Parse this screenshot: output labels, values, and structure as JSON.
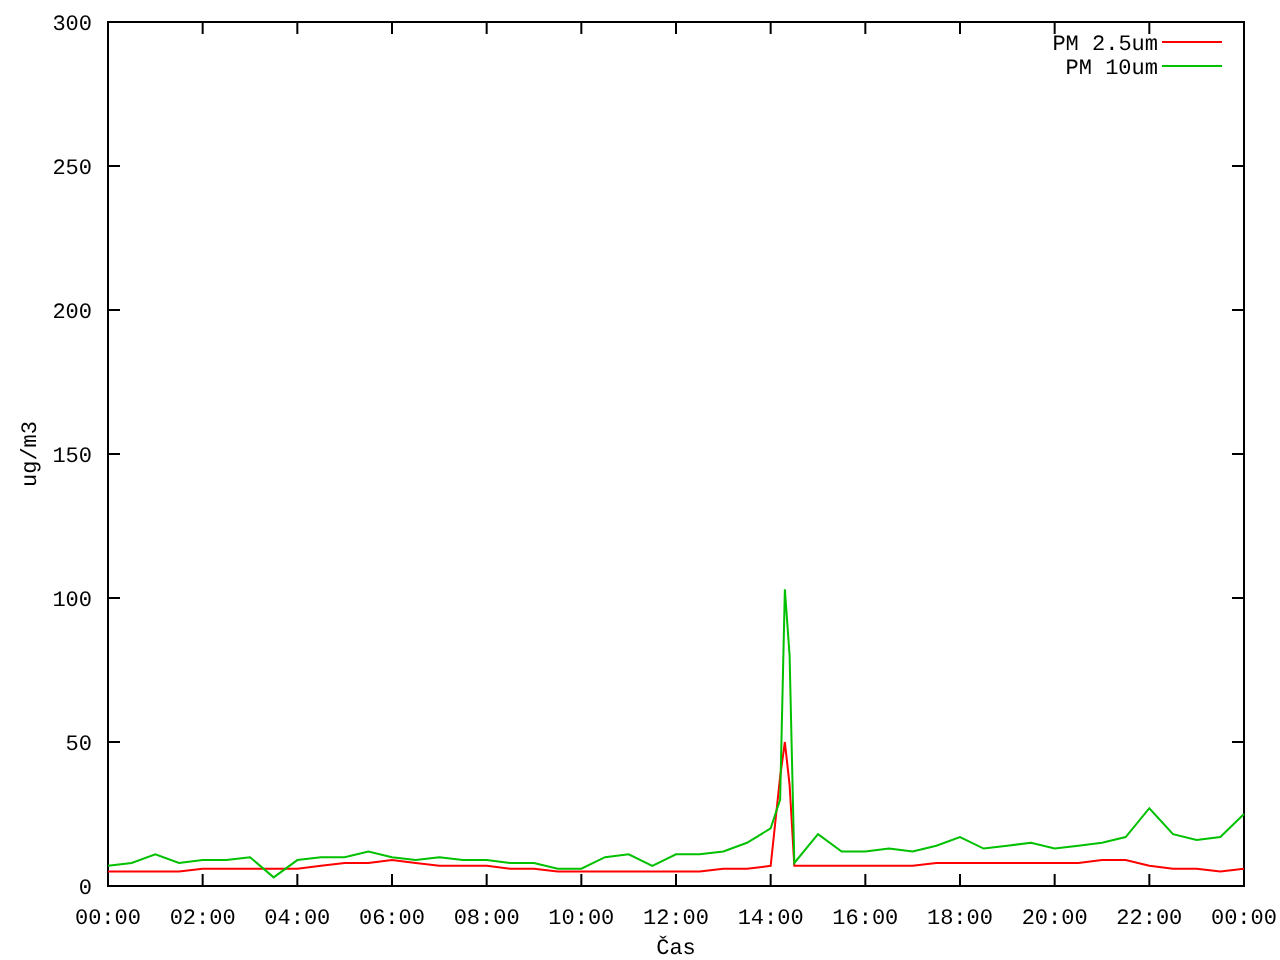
{
  "chart": {
    "chart_data": {
      "type": "line",
      "xlabel": "Čas",
      "ylabel": "ug/m3",
      "x": [
        0,
        0.5,
        1,
        1.5,
        2,
        2.5,
        3,
        3.5,
        4,
        4.5,
        5,
        5.5,
        6,
        6.5,
        7,
        7.5,
        8,
        8.5,
        9,
        9.5,
        10,
        10.5,
        11,
        11.5,
        12,
        12.5,
        13,
        13.5,
        14,
        14.2,
        14.3,
        14.4,
        14.5,
        15,
        15.5,
        16,
        16.5,
        17,
        17.5,
        18,
        18.5,
        19,
        19.5,
        20,
        20.5,
        21,
        21.5,
        22,
        22.5,
        23,
        23.5,
        24
      ],
      "series": [
        {
          "name": "PM 2.5um",
          "color": "#ff0000",
          "values": [
            5,
            5,
            5,
            5,
            6,
            6,
            6,
            6,
            6,
            7,
            8,
            8,
            9,
            8,
            7,
            7,
            7,
            6,
            6,
            5,
            5,
            5,
            5,
            5,
            5,
            5,
            6,
            6,
            7,
            38,
            50,
            35,
            7,
            7,
            7,
            7,
            7,
            7,
            8,
            8,
            8,
            8,
            8,
            8,
            8,
            9,
            9,
            7,
            6,
            6,
            5,
            6
          ]
        },
        {
          "name": "PM 10um",
          "color": "#00c000",
          "values": [
            7,
            8,
            11,
            8,
            9,
            9,
            10,
            3,
            9,
            10,
            10,
            12,
            10,
            9,
            10,
            9,
            9,
            8,
            8,
            6,
            6,
            10,
            11,
            7,
            11,
            11,
            12,
            15,
            20,
            30,
            103,
            80,
            8,
            18,
            12,
            12,
            13,
            12,
            14,
            17,
            13,
            14,
            15,
            13,
            14,
            15,
            17,
            27,
            18,
            16,
            17,
            25
          ]
        }
      ],
      "xlim": [
        0,
        24
      ],
      "ylim": [
        0,
        300
      ],
      "xticks": [
        {
          "value": 0,
          "label": "00:00"
        },
        {
          "value": 2,
          "label": "02:00"
        },
        {
          "value": 4,
          "label": "04:00"
        },
        {
          "value": 6,
          "label": "06:00"
        },
        {
          "value": 8,
          "label": "08:00"
        },
        {
          "value": 10,
          "label": "10:00"
        },
        {
          "value": 12,
          "label": "12:00"
        },
        {
          "value": 14,
          "label": "14:00"
        },
        {
          "value": 16,
          "label": "16:00"
        },
        {
          "value": 18,
          "label": "18:00"
        },
        {
          "value": 20,
          "label": "20:00"
        },
        {
          "value": 22,
          "label": "22:00"
        },
        {
          "value": 24,
          "label": "00:00"
        }
      ],
      "yticks": [
        0,
        50,
        100,
        150,
        200,
        250,
        300
      ],
      "legend": "top right"
    }
  }
}
